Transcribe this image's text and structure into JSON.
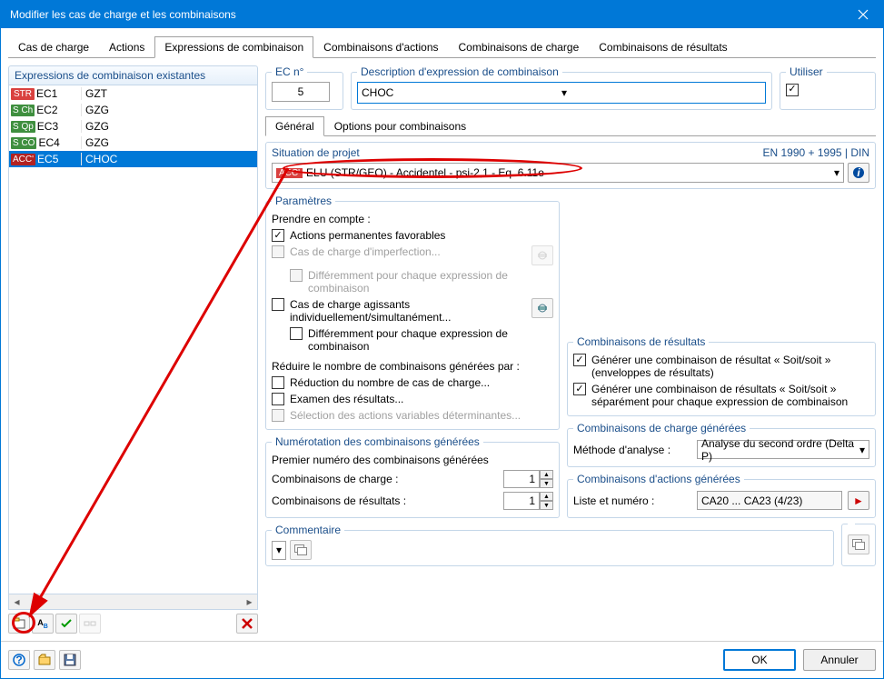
{
  "window": {
    "title": "Modifier les cas de charge et les combinaisons"
  },
  "main_tabs": [
    "Cas de charge",
    "Actions",
    "Expressions de combinaison",
    "Combinaisons d'actions",
    "Combinaisons de charge",
    "Combinaisons de résultats"
  ],
  "main_tab_active": 2,
  "left": {
    "title": "Expressions de combinaison existantes",
    "rows": [
      {
        "badge": "STR",
        "badge_class": "red",
        "code": "EC1",
        "desc": "GZT"
      },
      {
        "badge": "S Ch",
        "badge_class": "green",
        "code": "EC2",
        "desc": "GZG"
      },
      {
        "badge": "S Qp",
        "badge_class": "green",
        "code": "EC3",
        "desc": "GZG"
      },
      {
        "badge": "S CO",
        "badge_class": "green",
        "code": "EC4",
        "desc": "GZG"
      },
      {
        "badge": "ACC'",
        "badge_class": "darkred",
        "code": "EC5",
        "desc": "CHOC"
      }
    ],
    "selected": 4
  },
  "ec_num": {
    "label": "EC n°",
    "value": "5"
  },
  "desc": {
    "label": "Description d'expression de combinaison",
    "value": "CHOC"
  },
  "use": {
    "label": "Utiliser",
    "checked": true
  },
  "sub_tabs": [
    "Général",
    "Options pour combinaisons"
  ],
  "sub_tab_active": 0,
  "situation": {
    "label": "Situation de projet",
    "norm": "EN 1990 + 1995 | DIN",
    "badge": "ACC'",
    "value": "ELU (STR/GEO) - Accidentel - psi-2,1 - Eq. 6.11e"
  },
  "params": {
    "title": "Paramètres",
    "intro": "Prendre en compte :",
    "p1": {
      "label": "Actions permanentes favorables",
      "checked": true
    },
    "p2": {
      "label": "Cas de charge d'imperfection...",
      "checked": false,
      "disabled": true
    },
    "p2b": {
      "label": "Différemment pour chaque expression de combinaison",
      "checked": false,
      "disabled": true
    },
    "p3": {
      "label": "Cas de charge agissants individuellement/simultanément...",
      "checked": false
    },
    "p3b": {
      "label": "Différemment pour chaque expression de combinaison",
      "checked": false
    },
    "reduce": "Réduire le nombre de combinaisons générées par :",
    "r1": {
      "label": "Réduction du nombre de cas de charge...",
      "checked": false
    },
    "r2": {
      "label": "Examen des résultats...",
      "checked": false
    },
    "r3": {
      "label": "Sélection des actions variables déterminantes...",
      "checked": false,
      "disabled": true
    }
  },
  "numbering": {
    "title": "Numérotation des combinaisons générées",
    "intro": "Premier numéro des combinaisons générées",
    "n1_label": "Combinaisons de charge :",
    "n1_value": "1",
    "n2_label": "Combinaisons de résultats :",
    "n2_value": "1"
  },
  "res_comb": {
    "title": "Combinaisons de résultats",
    "c1": {
      "label": "Générer une combinaison de résultat « Soit/soit » (enveloppes de résultats)",
      "checked": true
    },
    "c2": {
      "label": "Générer une combinaison de résultats « Soit/soit » séparément pour chaque expression de combinaison",
      "checked": true
    }
  },
  "load_comb": {
    "title": "Combinaisons de charge générées",
    "method_label": "Méthode d'analyse :",
    "method_value": "Analyse du second ordre (Delta P)"
  },
  "action_comb": {
    "title": "Combinaisons d'actions générées",
    "list_label": "Liste et numéro :",
    "list_value": "CA20 ... CA23 (4/23)"
  },
  "comment": {
    "label": "Commentaire",
    "value": ""
  },
  "footer": {
    "ok": "OK",
    "cancel": "Annuler"
  }
}
